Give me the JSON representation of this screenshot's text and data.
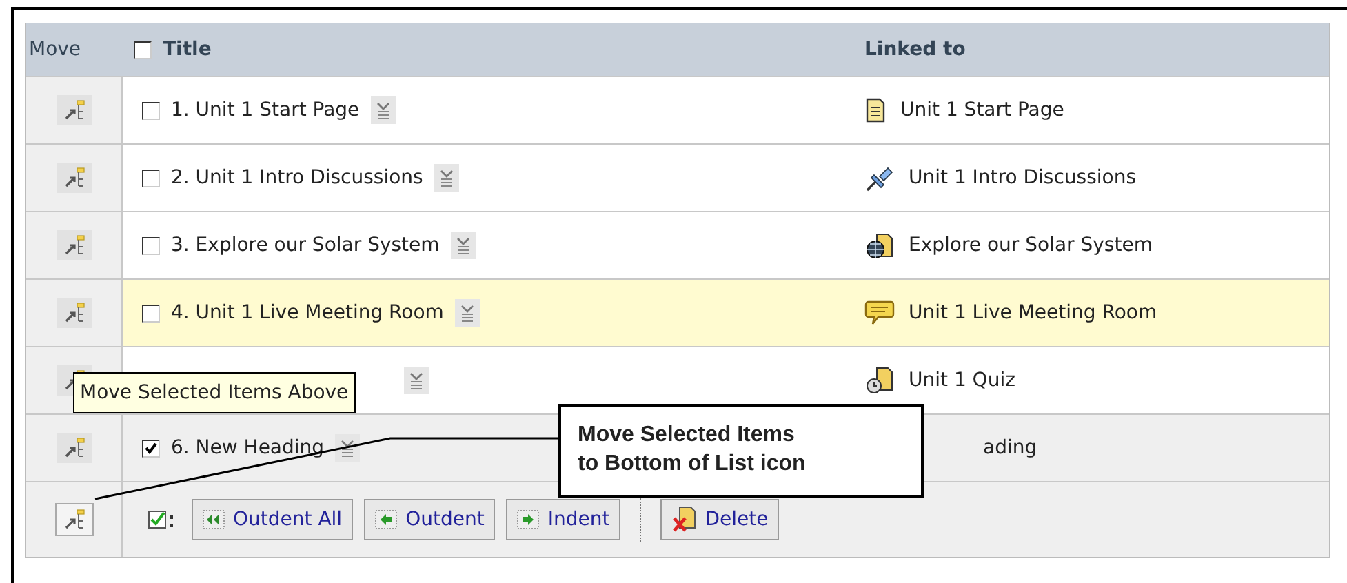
{
  "header": {
    "move": "Move",
    "select_all_checked": false,
    "title": "Title",
    "linked_to": "Linked to"
  },
  "rows": [
    {
      "kind": "item",
      "title": "1. Unit 1 Start Page",
      "checked": false,
      "highlighted": false,
      "link": {
        "kind": "page",
        "text": "Unit 1 Start Page"
      }
    },
    {
      "kind": "item",
      "title": "2. Unit 1 Intro Discussions",
      "checked": false,
      "highlighted": false,
      "link": {
        "kind": "discussion",
        "text": "Unit 1 Intro Discussions"
      }
    },
    {
      "kind": "item",
      "title": "3. Explore our Solar System",
      "checked": false,
      "highlighted": false,
      "link": {
        "kind": "website",
        "text": "Explore our Solar System"
      }
    },
    {
      "kind": "item",
      "title": "4. Unit 1 Live Meeting Room",
      "checked": false,
      "highlighted": true,
      "link": {
        "kind": "meeting",
        "text": "Unit 1 Live Meeting Room"
      }
    },
    {
      "kind": "item",
      "highlighted": false,
      "link": {
        "kind": "quiz",
        "text": "Unit 1 Quiz"
      }
    },
    {
      "kind": "heading",
      "title": "6. New Heading",
      "checked": true,
      "highlighted": false,
      "link": {
        "text": "ading"
      }
    }
  ],
  "toolbar": {
    "buttons": [
      {
        "kind": "outdent_all",
        "label": "Outdent All"
      },
      {
        "kind": "outdent",
        "label": "Outdent"
      },
      {
        "kind": "indent",
        "label": "Indent"
      },
      {
        "kind": "delete",
        "label": "Delete"
      }
    ]
  },
  "tooltip": "Move Selected Items Above",
  "callout": {
    "lines": [
      "Move Selected Items",
      "to Bottom of List icon"
    ]
  }
}
